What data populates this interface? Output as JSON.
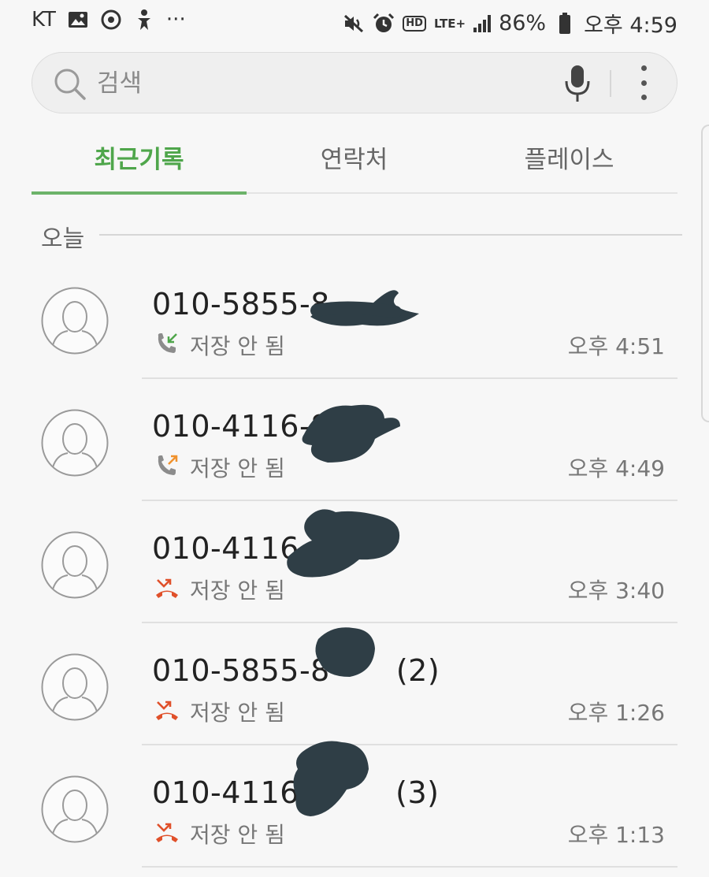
{
  "status_bar": {
    "carrier": "KT",
    "more": "···",
    "hd": "HD",
    "network": "LTE+",
    "battery": "86%",
    "time": "오후 4:59",
    "left_icons": [
      "gallery-icon",
      "sync-icon",
      "accessibility-icon"
    ],
    "right_icons": [
      "mute-icon",
      "alarm-icon",
      "hd-voice-icon",
      "lte-icon",
      "signal-icon",
      "battery-icon"
    ]
  },
  "search": {
    "placeholder": "검색",
    "icons": [
      "search-icon",
      "mic-icon",
      "more-vert-icon"
    ]
  },
  "tabs": [
    {
      "label": "최근기록",
      "active": true
    },
    {
      "label": "연락처",
      "active": false
    },
    {
      "label": "플레이스",
      "active": false
    }
  ],
  "section": {
    "label": "오늘"
  },
  "calls": [
    {
      "number": "010-5855-8",
      "count": "",
      "type": "incoming",
      "status": "저장 안 됨",
      "time": "오후 4:51"
    },
    {
      "number": "010-4116-8",
      "count": "",
      "type": "outgoing",
      "status": "저장 안 됨",
      "time": "오후 4:49"
    },
    {
      "number": "010-4116",
      "count": "",
      "type": "missed",
      "status": "저장 안 됨",
      "time": "오후 3:40"
    },
    {
      "number": "010-5855-8",
      "count": "(2)",
      "type": "missed",
      "status": "저장 안 됨",
      "time": "오후 1:26"
    },
    {
      "number": "010-4116-",
      "count": "(3)",
      "type": "missed",
      "status": "저장 안 됨",
      "time": "오후 1:13"
    }
  ],
  "colors": {
    "accent": "#4fa64b",
    "missed": "#e0502a",
    "outgoing": "#f0922e",
    "incoming": "#4fa64b",
    "redaction": "#2f3e46"
  }
}
